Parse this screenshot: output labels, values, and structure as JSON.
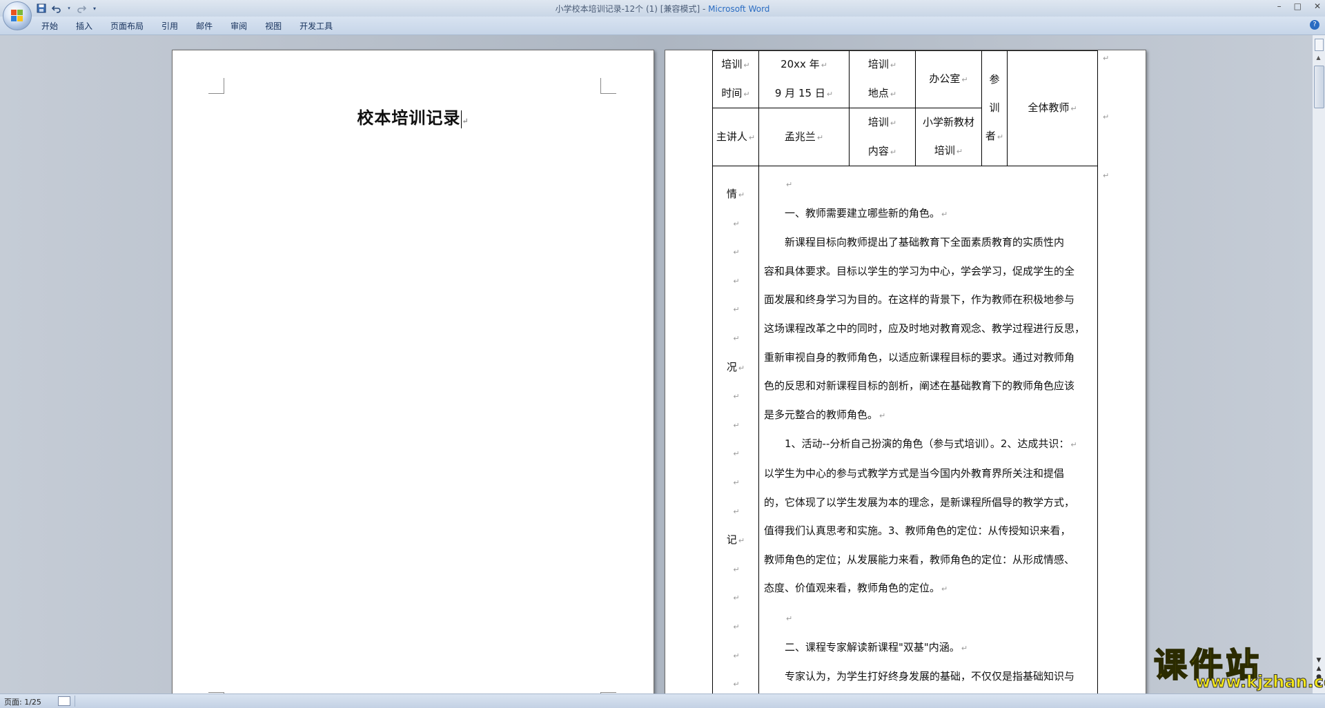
{
  "window": {
    "title_doc": "小学校本培训记录-12个 (1) [兼容模式]",
    "title_sep": " - ",
    "title_app": "Microsoft Word"
  },
  "quick_access": {
    "save_icon": "save-icon",
    "undo_icon": "undo-icon",
    "redo_icon": "redo-icon",
    "customize_icon": "dropdown-icon"
  },
  "ribbon": {
    "tabs": [
      "开始",
      "插入",
      "页面布局",
      "引用",
      "邮件",
      "审阅",
      "视图",
      "开发工具"
    ]
  },
  "page1": {
    "title": "校本培训记录"
  },
  "table": {
    "time_label_1": "培训",
    "time_label_2": "时间",
    "time_value_1": "20xx 年",
    "time_value_2": "9 月 15 日",
    "place_label_1": "培训",
    "place_label_2": "地点",
    "place_value": "办公室",
    "participants_label_1": "参",
    "participants_label_2": "训",
    "participants_label_3": "者",
    "participants_value": "全体教师",
    "speaker_label": "主讲人",
    "speaker_value": "孟兆兰",
    "content_label_1": "培训",
    "content_label_2": "内容",
    "content_value_1": "小学新教材",
    "content_value_2": "培训",
    "record_label_1": "情",
    "record_label_2": "况",
    "record_label_3": "记"
  },
  "body": {
    "heading1": "一、教师需要建立哪些新的角色。",
    "para1_line1": "新课程目标向教师提出了基础教育下全面素质教育的实质性内",
    "para1_line2": "容和具体要求。目标以学生的学习为中心，学会学习，促成学生的全",
    "para1_line3": "面发展和终身学习为目的。在这样的背景下，作为教师在积极地参与",
    "para1_line4": "这场课程改革之中的同时，应及时地对教育观念、教学过程进行反思，",
    "para1_line5": "重新审视自身的教师角色，以适应新课程目标的要求。通过对教师角",
    "para1_line6": "色的反思和对新课程目标的剖析，阐述在基础教育下的教师角色应该",
    "para1_line7": "是多元整合的教师角色。",
    "para2_line1": "1、活动--分析自己扮演的角色（参与式培训）。2、达成共识：",
    "para2_line2": "以学生为中心的参与式教学方式是当今国内外教育界所关注和提倡",
    "para2_line3": "的，它体现了以学生发展为本的理念，是新课程所倡导的教学方式，",
    "para2_line4": "值得我们认真思考和实施。3、教师角色的定位：从传授知识来看，",
    "para2_line5": "教师角色的定位；从发展能力来看，教师角色的定位：从形成情感、",
    "para2_line6": "态度、价值观来看，教师角色的定位。",
    "heading2": "二、课程专家解读新课程\"双基\"内涵。",
    "para3_line1": "专家认为，为学生打好终身发展的基础，不仅仅是指基础知识与"
  },
  "status": {
    "page": "页面: 1/25"
  },
  "watermark": {
    "main": "课件站",
    "url": "www.kjzhan.com"
  }
}
